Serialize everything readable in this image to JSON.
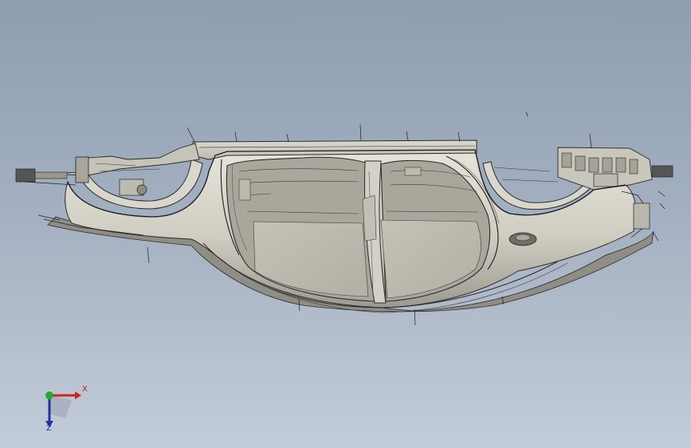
{
  "viewport": {
    "background_top": "#8f9db1",
    "background_bottom": "#c3ccd8",
    "model_name": "car-body-in-white"
  },
  "triad": {
    "x_label": "X",
    "z_label": "Z",
    "x_color": "#d32020",
    "y_color": "#22b022",
    "z_color": "#2030a0"
  }
}
